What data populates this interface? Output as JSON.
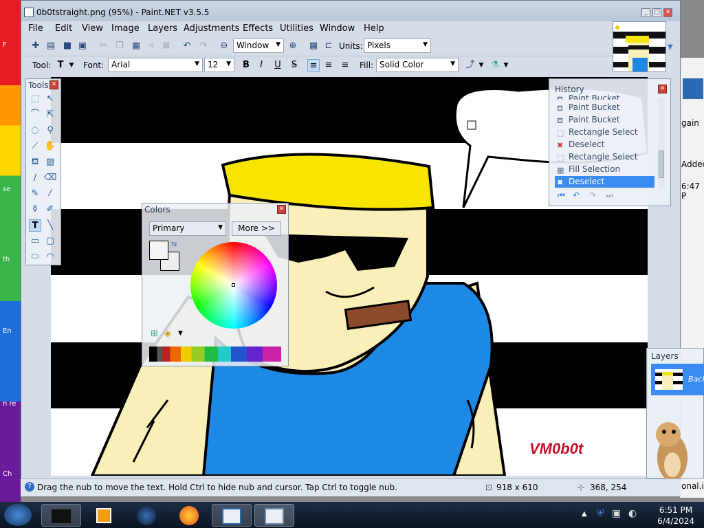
{
  "window": {
    "title": "0b0tstraight.png (95%) - Paint.NET v3.5.5"
  },
  "menu": [
    "File",
    "Edit",
    "View",
    "Image",
    "Layers",
    "Adjustments",
    "Effects",
    "Utilities",
    "Window",
    "Help"
  ],
  "toolbar": {
    "zoom_value": "Window",
    "units_label": "Units:",
    "units_value": "Pixels",
    "tool_label": "Tool:",
    "font_label": "Font:",
    "font_value": "Arial",
    "font_size": "12",
    "bold": "B",
    "italic": "I",
    "underline": "U",
    "strike": "S",
    "fill_label": "Fill:",
    "fill_value": "Solid Color"
  },
  "tools_panel": {
    "title": "Tools",
    "text_tool": "T"
  },
  "colors_panel": {
    "title": "Colors",
    "mode": "Primary",
    "more_button": "More >>"
  },
  "history_panel": {
    "title": "History",
    "items": [
      "Paint Bucket",
      "Paint Bucket",
      "Paint Bucket",
      "Rectangle Select",
      "Deselect",
      "Rectangle Select",
      "Fill Selection",
      "Deselect"
    ],
    "selected_index": 7
  },
  "layers_panel": {
    "title": "Layers",
    "layer_name": "Back"
  },
  "canvas": {
    "watermark": "VM0b0t"
  },
  "status": {
    "hint": "Drag the nub to move the text. Hold Ctrl to hide nub and cursor. Tap Ctrl to toggle nub.",
    "image_size": "918 x 610",
    "cursor_pos": "368, 254"
  },
  "background_window": {
    "texts": [
      "gain",
      "Added",
      "6:47 P",
      "onal.i"
    ]
  },
  "desktop_strip": {
    "texts": [
      "F",
      "se",
      "th",
      "En",
      "n re",
      "Ch"
    ]
  },
  "clock": {
    "time": "6:51 PM",
    "date": "6/4/2024"
  },
  "colors": {
    "accent_selected": "#3b8cf0",
    "shirt": "#1e88e5",
    "hair": "#f7e500",
    "skin": "#f9efb8"
  }
}
